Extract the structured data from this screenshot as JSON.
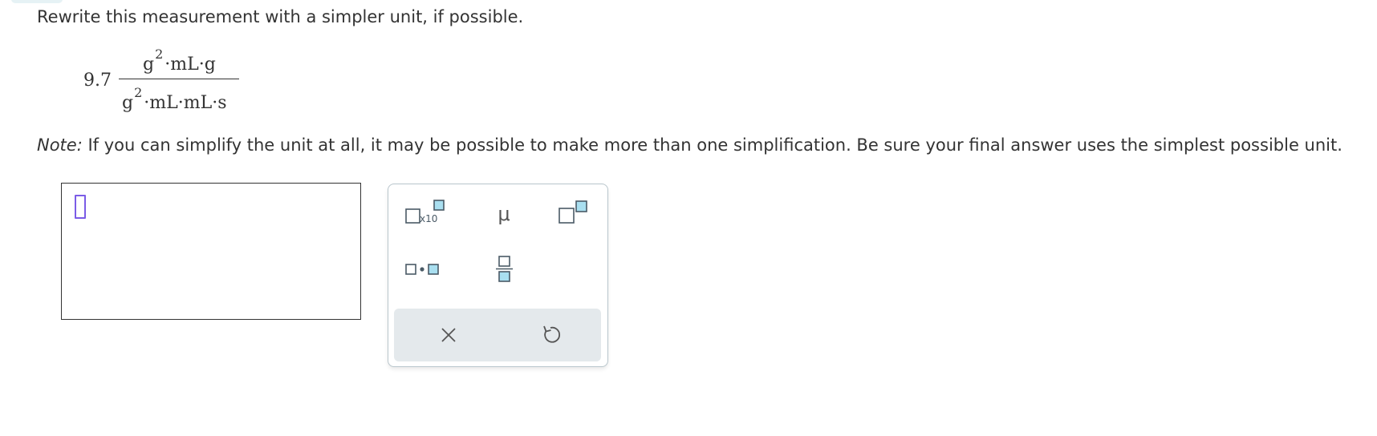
{
  "question": {
    "prompt": "Rewrite this measurement with a simpler unit, if possible.",
    "expression": {
      "coefficient": "9.7",
      "numerator": {
        "g": "g",
        "exp": "2",
        "mid": "·mL·g"
      },
      "denominator": {
        "g": "g",
        "exp": "2",
        "mid": "·mL·mL·s"
      }
    },
    "note_label": "Note:",
    "note_text": " If you can simplify the unit at all, it may be possible to make more than one simplification. Be sure your final answer uses the simplest possible unit."
  },
  "answer": {
    "value": ""
  },
  "palette": {
    "buttons": [
      {
        "id": "sci-notation",
        "icon": "times-ten-icon",
        "label": "x10"
      },
      {
        "id": "micro",
        "icon": "mu-icon",
        "label": "μ"
      },
      {
        "id": "superscript",
        "icon": "superscript-icon",
        "label": ""
      },
      {
        "id": "multiply-dot",
        "icon": "dot-product-icon",
        "label": ""
      },
      {
        "id": "fraction",
        "icon": "fraction-icon",
        "label": ""
      },
      {
        "id": "clear",
        "icon": "close-icon",
        "label": ""
      },
      {
        "id": "undo",
        "icon": "undo-icon",
        "label": ""
      }
    ],
    "colors": {
      "box_fill": "#a9dff0",
      "box_stroke": "#4a5a66",
      "icon": "#555555",
      "cursor": "#7b5ce6"
    }
  }
}
